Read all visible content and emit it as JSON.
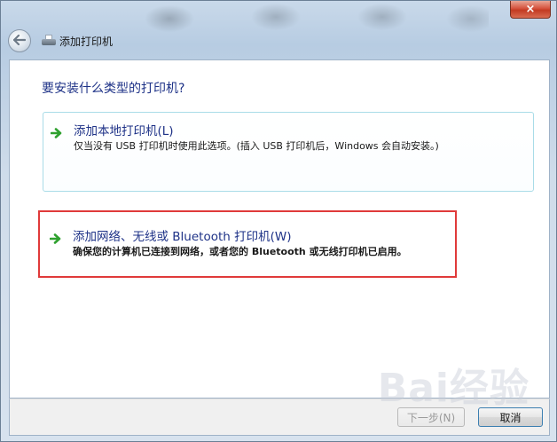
{
  "window": {
    "title": "添加打印机",
    "close_label": "×"
  },
  "main": {
    "heading": "要安装什么类型的打印机?",
    "options": [
      {
        "title": "添加本地打印机(L)",
        "description": "仅当没有 USB 打印机时使用此选项。(插入 USB 打印机后，Windows 会自动安装。)"
      },
      {
        "title": "添加网络、无线或 Bluetooth 打印机(W)",
        "description": "确保您的计算机已连接到网络，或者您的 Bluetooth 或无线打印机已启用。"
      }
    ]
  },
  "footer": {
    "next_label": "下一步(N)",
    "cancel_label": "取消"
  },
  "watermark": "Bai经验",
  "colors": {
    "heading": "#1e3287",
    "highlight": "#e03a3a",
    "option_border": "#a9dce8",
    "arrow": "#2fa12f"
  },
  "icons": [
    "back-arrow-icon",
    "printer-icon",
    "green-arrow-icon",
    "close-icon"
  ]
}
